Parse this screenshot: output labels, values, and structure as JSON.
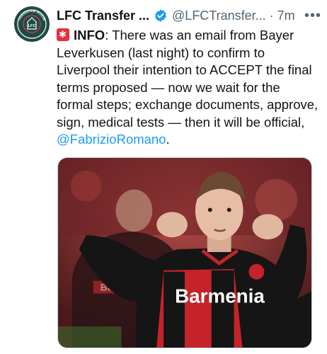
{
  "tweet": {
    "author_name": "LFC Transfer ...",
    "handle": "@LFCTransfer...",
    "separator": "·",
    "time": "7m",
    "more": "•••",
    "text_intro_bold": "INFO",
    "text_body": ": There was an email from Bayer Leverkusen (last night) to confirm to Liverpool their intention to ACCEPT the final terms proposed — now we wait for the formal steps; exchange documents, approve, sign, medical tests — then it will be official, ",
    "mention": "@FabrizioRomano",
    "text_end": "."
  },
  "avatar": {
    "icon": "lfc-transfer-room-logo",
    "text": "TRANSFER ROOM",
    "letters": "LFC"
  },
  "media": {
    "shirt_text": "Barmenia"
  },
  "colors": {
    "verified": "#1d9bf0",
    "mention": "#1d9bf0",
    "muted": "#536471",
    "siren": "#e0323f"
  }
}
